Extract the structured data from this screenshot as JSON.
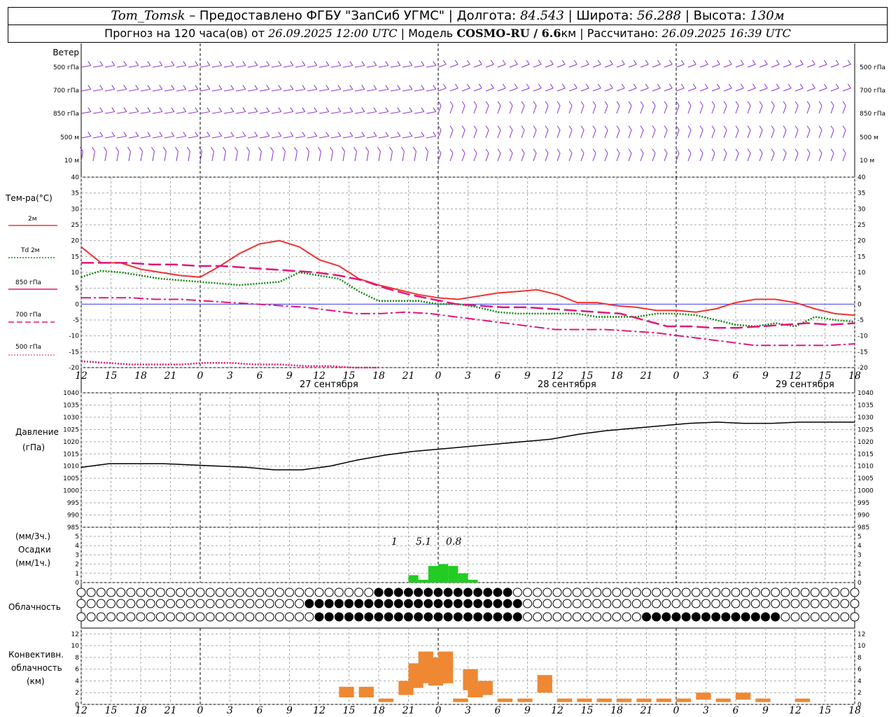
{
  "header": {
    "station": "Tom_Tomsk",
    "provided": " – Предоставлено ФГБУ \"ЗапСиб УГМС\" | Долгота: ",
    "lon": "84.543",
    "lat_label": " | Широта: ",
    "lat": "56.288",
    "alt_label": " | Высота: ",
    "alt": "130м",
    "forecast_prefix": "Прогноз на 120 часа(ов) от ",
    "forecast_time": "26.09.2025 12:00 UTC",
    "model_prefix": " | Модель ",
    "model": "COSMO-RU / 6.6",
    "model_unit": "км",
    "calc_prefix": " | Рассчитано: ",
    "calc_time": "26.09.2025 16:39 UTC"
  },
  "panels": {
    "wind": {
      "title": "Ветер",
      "levels": [
        "500 гПа",
        "700 гПа",
        "850 гПа",
        "500 м",
        "10 м"
      ]
    },
    "temp": {
      "title": "Тем-ра(°C)",
      "legend": [
        "2м",
        "Td 2м",
        "850 гПа",
        "700 гПа",
        "500 гПа"
      ]
    },
    "pressure": {
      "title": "Давление",
      "unit": "(гПа)"
    },
    "precip": {
      "unit1": "(мм/3ч.)",
      "title": "Осадки",
      "unit2": "(мм/1ч.)",
      "annotations": [
        "1",
        "5.1",
        "0.8"
      ]
    },
    "cloud": {
      "title": "Облачность"
    },
    "conv": {
      "title1": "Конвективн.",
      "title2": "облачность",
      "unit": "(км)"
    }
  },
  "dates": [
    "27 сентября",
    "28 сентября",
    "29 сентября"
  ],
  "colors": {
    "t2m": "#ee3333",
    "td": "#118811",
    "t850": "#e0187a",
    "wind": "#8833cc",
    "precip": "#22cc22",
    "conv": "#ee8833"
  },
  "chart_data": [
    {
      "type": "line",
      "title": "Тем-ра(°C)",
      "x_ticks": [
        "12",
        "15",
        "18",
        "21",
        "0",
        "3",
        "6",
        "9",
        "12",
        "15",
        "18",
        "21",
        "0",
        "3",
        "6",
        "9",
        "12",
        "15",
        "18",
        "21",
        "0",
        "3",
        "6",
        "9",
        "12",
        "15",
        "18"
      ],
      "ylim": [
        -20,
        40
      ],
      "x_hours": [
        0,
        3,
        6,
        9,
        12,
        15,
        18,
        21,
        24,
        27,
        30,
        33,
        36,
        39,
        42,
        45,
        48,
        51,
        54,
        57,
        60,
        63,
        66,
        69,
        72,
        75,
        78
      ],
      "series": [
        {
          "name": "2м",
          "values": [
            18,
            13,
            13,
            11,
            10,
            9,
            8.5,
            12,
            16,
            19,
            20,
            18,
            14,
            12,
            8,
            6,
            4.5,
            3,
            2,
            1.5,
            2.5,
            3.5,
            4,
            4.5,
            3,
            0.5,
            0.5,
            -0.5,
            -1,
            -2,
            -2,
            -2.5,
            -1.5,
            0.5,
            1.5,
            1.5,
            0.5,
            -1.5,
            -3,
            -3.5
          ]
        },
        {
          "name": "Td 2м",
          "values": [
            8.5,
            10.5,
            10,
            9,
            8,
            7.5,
            7,
            6.5,
            6,
            6.5,
            7,
            10,
            9,
            8,
            4,
            1,
            1,
            1,
            0,
            0,
            -1,
            -2.5,
            -3,
            -3,
            -3,
            -3,
            -4,
            -4,
            -4,
            -3,
            -3,
            -3.5,
            -5,
            -6.5,
            -7,
            -6,
            -7,
            -4,
            -5,
            -5.5
          ]
        },
        {
          "name": "850 гПа",
          "values": [
            13,
            13,
            13,
            12.5,
            12.5,
            12,
            12,
            11.5,
            11,
            10.5,
            10,
            9,
            7.5,
            5,
            3,
            1.5,
            0,
            -0.5,
            -1,
            -1,
            -1.5,
            -2,
            -2.5,
            -3,
            -5,
            -7,
            -7,
            -7.5,
            -7.5,
            -7,
            -6.5,
            -6,
            -6.5,
            -6
          ]
        },
        {
          "name": "700 гПа",
          "values": [
            2,
            2,
            2,
            1.5,
            1.5,
            1,
            0.5,
            0,
            -0.5,
            -1,
            -2,
            -3,
            -3,
            -2.5,
            -3,
            -4,
            -5,
            -6,
            -7,
            -8,
            -8,
            -8,
            -8.5,
            -9,
            -10,
            -11,
            -12,
            -13,
            -13,
            -13,
            -13,
            -12.5
          ]
        },
        {
          "name": "500 гПа",
          "values": [
            -18,
            -18.5,
            -19,
            -19,
            -19,
            -18.5,
            -18.5,
            -19,
            -19,
            -19.5,
            -19.5,
            -20,
            -20
          ]
        }
      ]
    },
    {
      "type": "line",
      "title": "Давление",
      "ylim": [
        985,
        1040
      ],
      "values": [
        1009.5,
        1011,
        1011,
        1011,
        1010.5,
        1010,
        1009.5,
        1008.5,
        1008.5,
        1010,
        1012.5,
        1014.5,
        1016,
        1017,
        1018,
        1019,
        1020,
        1021,
        1023,
        1024.5,
        1025.5,
        1026.5,
        1027.5,
        1028,
        1027.5,
        1027.5,
        1028,
        1028,
        1028
      ]
    },
    {
      "type": "bar",
      "title": "Осадки",
      "ylim": [
        0,
        5
      ],
      "values": [
        0.8,
        0.3,
        1.8,
        2.0,
        1.8,
        1.0,
        0.3
      ]
    },
    {
      "type": "bar",
      "title": "Конвективн. облачность",
      "ylim": [
        0,
        13
      ],
      "values": [
        3,
        3,
        1,
        4,
        7,
        9,
        8,
        9,
        1,
        6,
        3,
        4,
        1,
        1,
        5,
        1,
        1,
        1,
        1,
        1,
        1,
        1,
        2,
        1,
        2,
        1,
        1
      ]
    }
  ]
}
